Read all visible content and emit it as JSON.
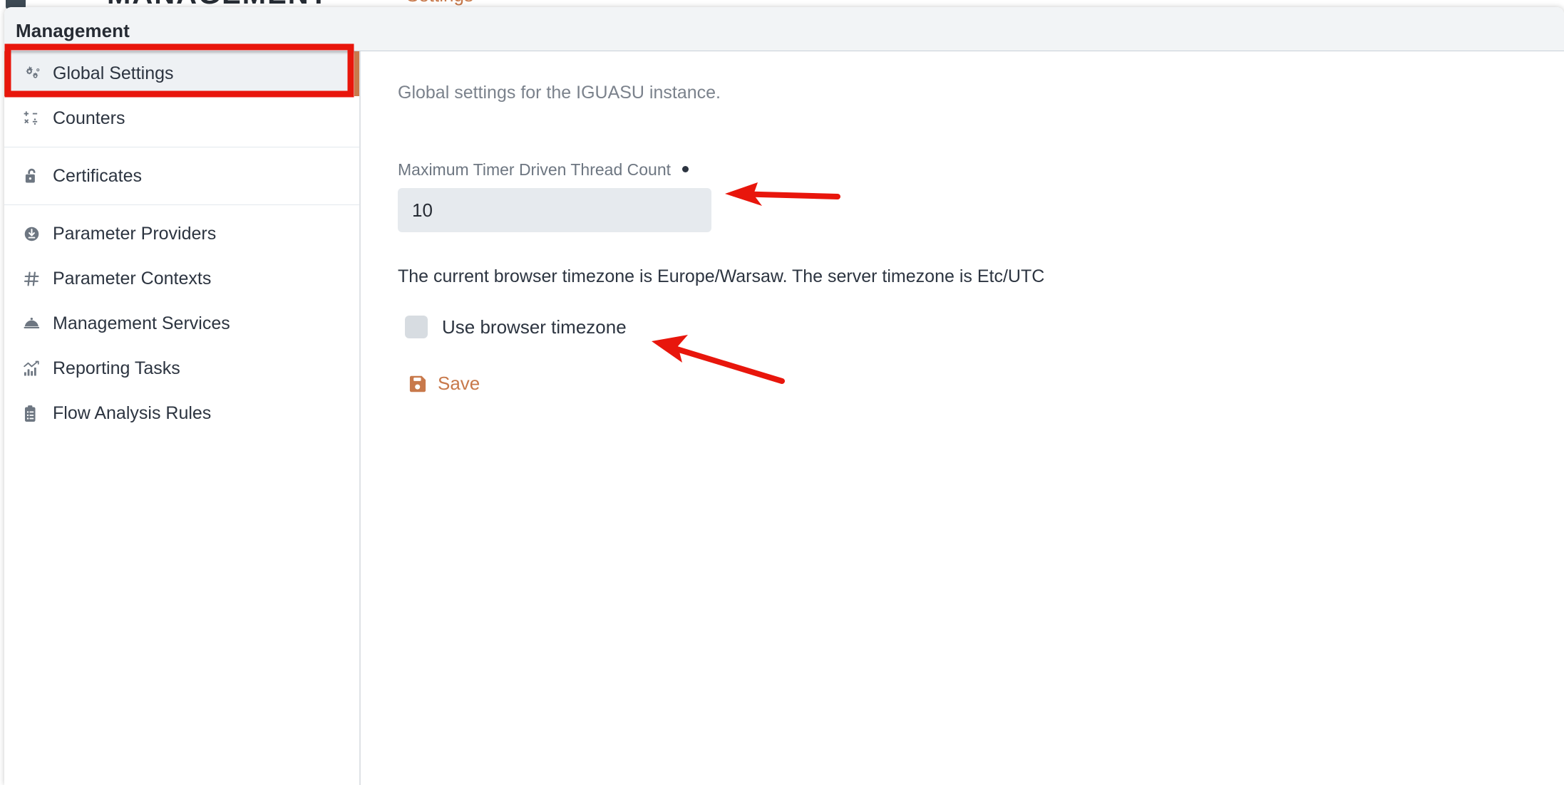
{
  "background_page": {
    "cut_off_title": "MANAGEMENT",
    "cut_off_secondary": "Settings"
  },
  "panel": {
    "title": "Management"
  },
  "sidebar": {
    "groups": [
      {
        "items": [
          {
            "label": "Global Settings",
            "icon": "gears-icon",
            "selected": true
          },
          {
            "label": "Counters",
            "icon": "counters-icon",
            "selected": false
          }
        ]
      },
      {
        "items": [
          {
            "label": "Certificates",
            "icon": "padlock-icon",
            "selected": false
          }
        ]
      },
      {
        "items": [
          {
            "label": "Parameter Providers",
            "icon": "download-circle-icon",
            "selected": false
          },
          {
            "label": "Parameter Contexts",
            "icon": "hash-icon",
            "selected": false
          },
          {
            "label": "Management Services",
            "icon": "service-bell-icon",
            "selected": false
          },
          {
            "label": "Reporting Tasks",
            "icon": "bar-chart-icon",
            "selected": false
          },
          {
            "label": "Flow Analysis Rules",
            "icon": "clipboard-icon",
            "selected": false
          }
        ]
      }
    ]
  },
  "main": {
    "subtitle": "Global settings for the IGUASU instance.",
    "max_timer_thread": {
      "label": "Maximum Timer Driven Thread Count",
      "required_marker": "•",
      "value": "10",
      "placeholder": ""
    },
    "timezone_note": "The current browser timezone is Europe/Warsaw. The server timezone is Etc/UTC",
    "use_browser_timezone": {
      "label": "Use browser timezone",
      "checked": false
    },
    "save_button": {
      "label": "Save",
      "icon": "save-floppy-icon"
    }
  },
  "annotations": {
    "accent_color": "#e8160c",
    "highlight_box": {
      "target": "Global Settings"
    },
    "arrows": [
      {
        "points_to": "Maximum Timer Driven Thread Count"
      },
      {
        "points_to": "Use browser timezone"
      }
    ]
  },
  "colors": {
    "brand_orange": "#c8794b",
    "header_bg": "#f2f4f6",
    "text_primary": "#2c3440",
    "text_muted": "#7b828c",
    "input_bg": "#e6eaee",
    "annotation_red": "#e8160c"
  }
}
